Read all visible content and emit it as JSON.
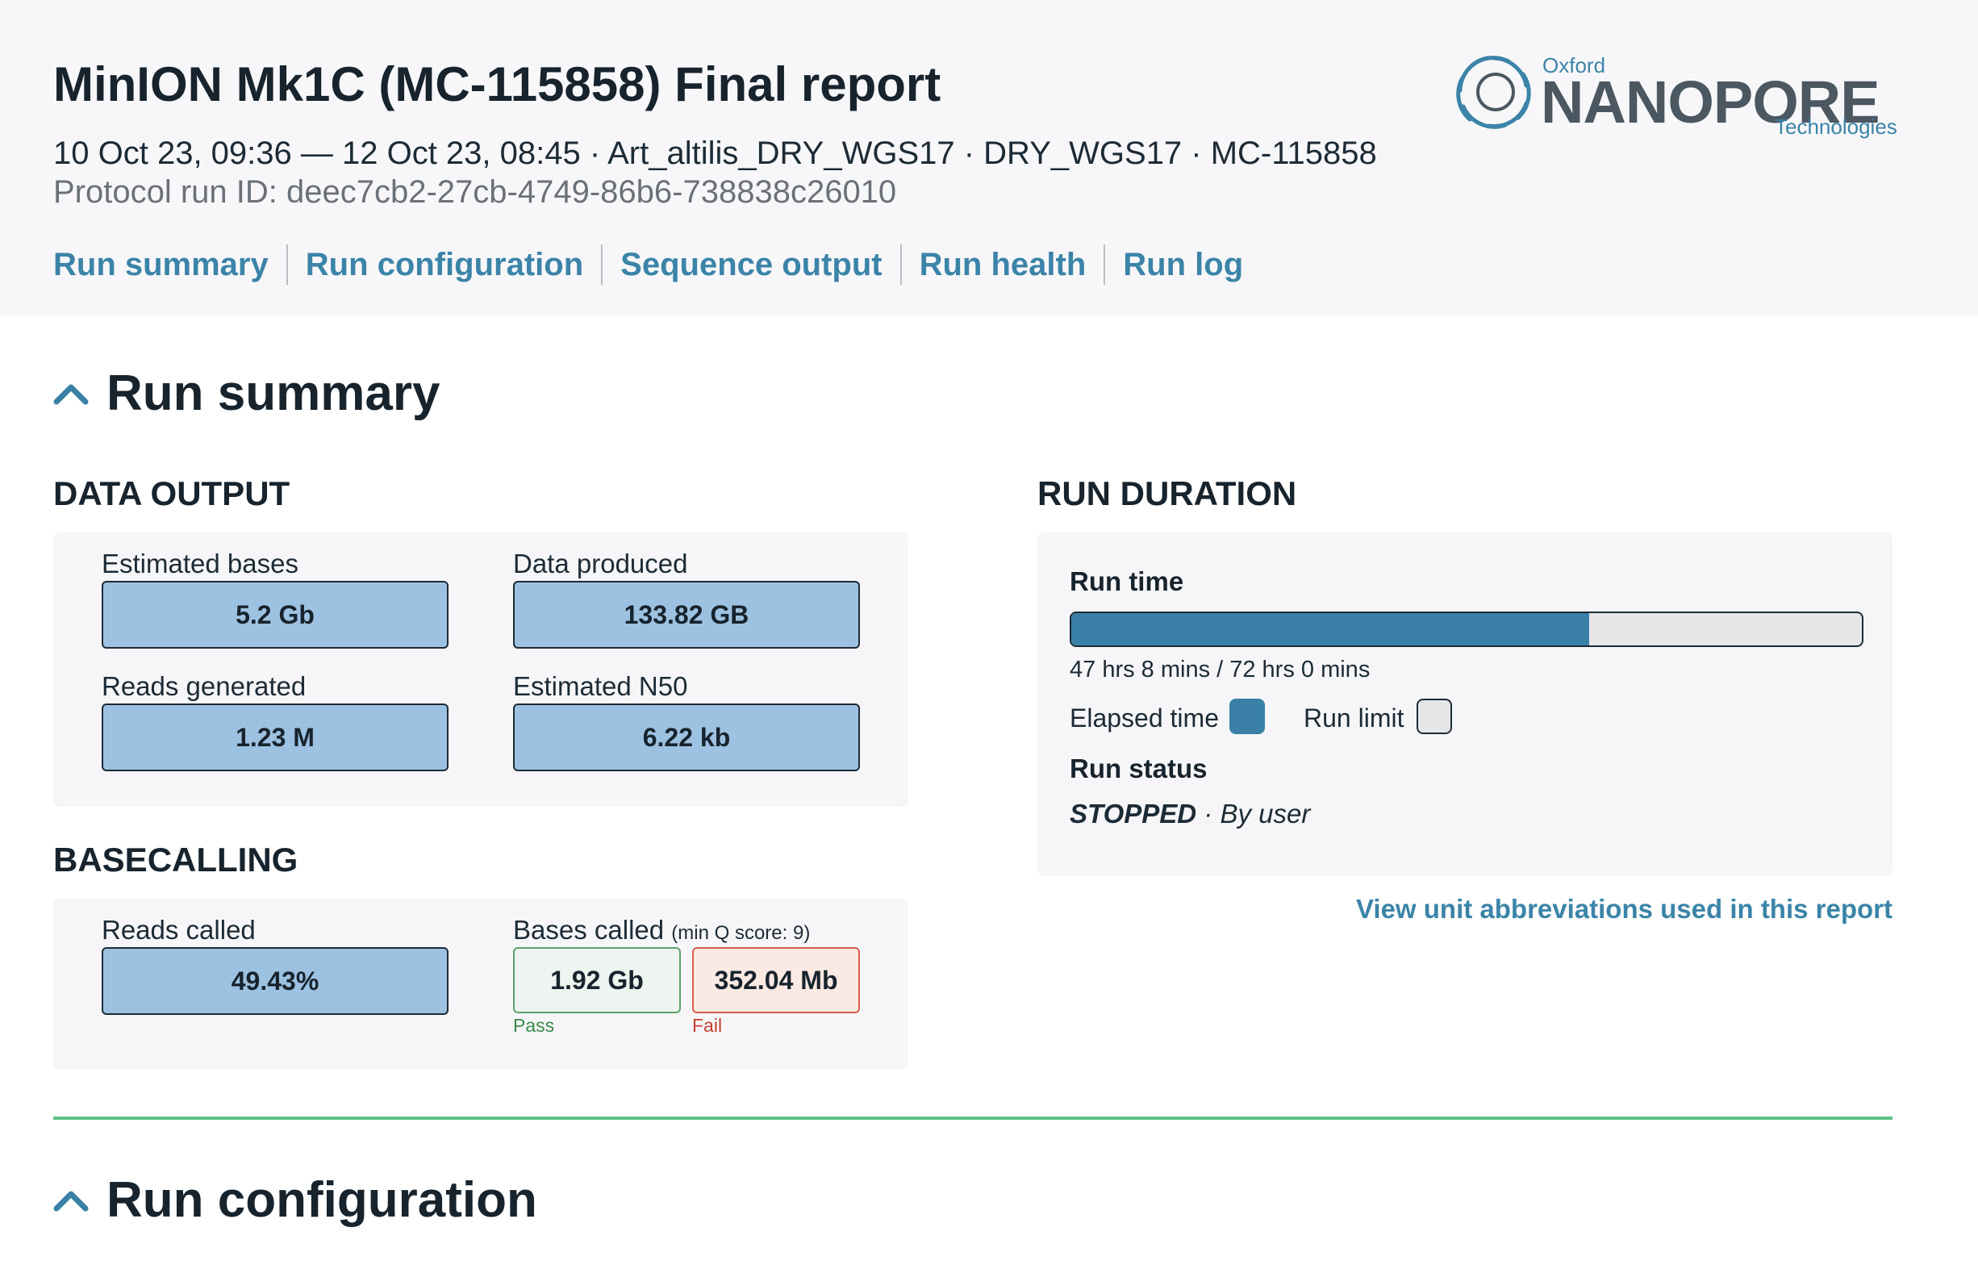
{
  "header": {
    "title": "MinION Mk1C (MC-115858) Final report",
    "meta": "10 Oct 23, 09:36 — 12 Oct 23, 08:45 · Art_altilis_DRY_WGS17 · DRY_WGS17 · MC-115858",
    "protocol_run_id": "Protocol run ID: deec7cb2-27cb-4749-86b6-738838c26010",
    "nav": [
      "Run summary",
      "Run configuration",
      "Sequence output",
      "Run health",
      "Run log"
    ]
  },
  "logo": {
    "oxford": "Oxford",
    "nanopore": "NANOPORE",
    "technologies": "Technologies"
  },
  "run_summary": {
    "heading": "Run summary",
    "data_output": {
      "heading": "DATA OUTPUT",
      "estimated_bases": {
        "label": "Estimated bases",
        "value": "5.2 Gb"
      },
      "data_produced": {
        "label": "Data produced",
        "value": "133.82 GB"
      },
      "reads_generated": {
        "label": "Reads generated",
        "value": "1.23 M"
      },
      "estimated_n50": {
        "label": "Estimated N50",
        "value": "6.22 kb"
      }
    },
    "basecalling": {
      "heading": "BASECALLING",
      "reads_called": {
        "label": "Reads called",
        "value": "49.43%"
      },
      "bases_called": {
        "label": "Bases called",
        "note": "(min Q score: 9)",
        "pass_value": "1.92 Gb",
        "pass_label": "Pass",
        "fail_value": "352.04 Mb",
        "fail_label": "Fail"
      }
    },
    "run_duration": {
      "heading": "RUN DURATION",
      "run_time_label": "Run time",
      "run_time_text": "47 hrs 8 mins / 72 hrs 0 mins",
      "elapsed_fraction": 0.6546,
      "legend_elapsed": "Elapsed time",
      "legend_limit": "Run limit",
      "run_status_label": "Run status",
      "status": "STOPPED",
      "status_reason": "· By user",
      "colors": {
        "elapsed": "#3a80a6",
        "limit": "#e6e6e8"
      }
    },
    "abbreviations_link": "View unit abbreviations used in this report"
  },
  "run_configuration": {
    "heading": "Run configuration"
  },
  "colors": {
    "accent": "#3b84a8",
    "metric_fill": "#9dc2e1",
    "pass": "#5aa36a",
    "fail": "#d4604c",
    "divider": "#5cc18a"
  }
}
